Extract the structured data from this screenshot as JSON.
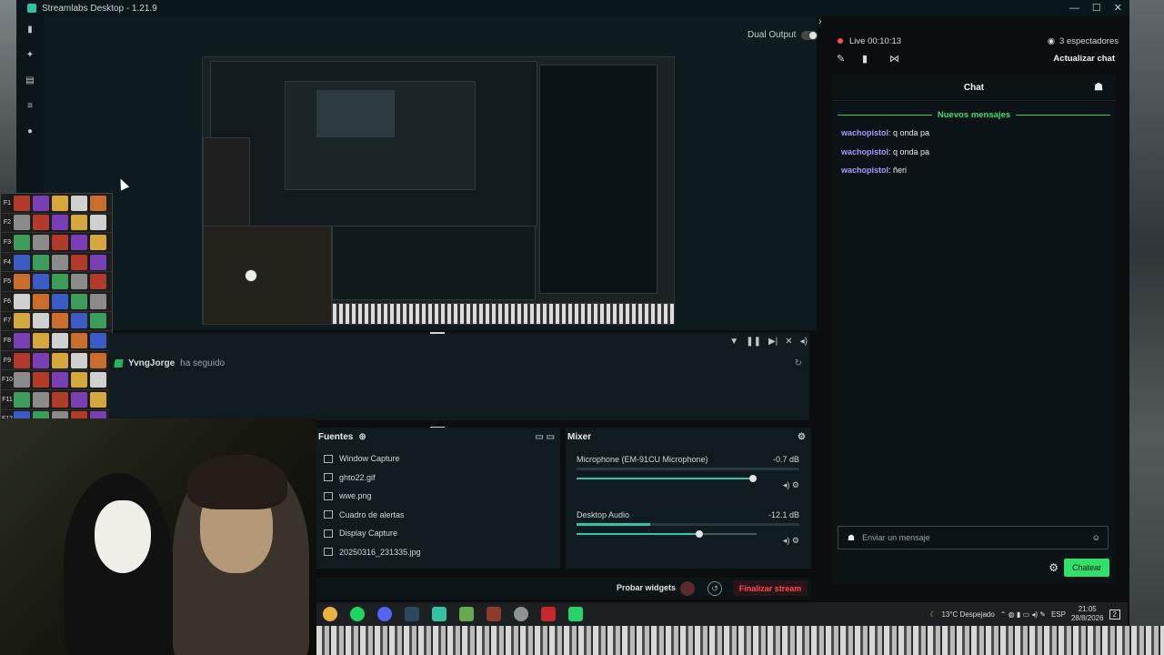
{
  "window": {
    "title": "Streamlabs Desktop - 1.21.9"
  },
  "editor": {
    "dual_output_label": "Dual Output"
  },
  "hotbar": {
    "keys": [
      "F1",
      "F2",
      "F3",
      "F4",
      "F5",
      "F6",
      "F7",
      "F8",
      "F9",
      "F10",
      "F11",
      "F12"
    ]
  },
  "activity": {
    "username": "YvngJorge",
    "action": "ha seguido"
  },
  "sources": {
    "title": "Fuentes",
    "items": [
      "Window Capture",
      "ghto22.gif",
      "wwe.png",
      "Cuadro de alertas",
      "Display Capture",
      "20250316_231335.jpg"
    ]
  },
  "mixer": {
    "title": "Mixer",
    "channels": [
      {
        "name": "Microphone (EM-91CU Microphone)",
        "db": "-0.7 dB",
        "volume": 0.98
      },
      {
        "name": "Desktop Audio",
        "db": "-12.1 dB",
        "volume": 0.68
      }
    ]
  },
  "bottombar": {
    "test_widgets": "Probar widgets",
    "end_stream": "Finalizar stream"
  },
  "live": {
    "status": "Live 00:10:13",
    "viewers": "3 espectadores",
    "refresh_chat": "Actualizar chat"
  },
  "chat": {
    "title": "Chat",
    "new_messages": "Nuevos mensajes",
    "messages": [
      {
        "user": "wachopistol",
        "text": ": q onda pa"
      },
      {
        "user": "wachopistol",
        "text": ": q onda pa"
      },
      {
        "user": "wachopistol",
        "text": ": ñeri"
      }
    ],
    "input_placeholder": "Enviar un mensaje",
    "send_label": "Chatear"
  },
  "taskbar": {
    "weather": "13°C  Despejado",
    "language": "ESP",
    "time": "21:05",
    "date": "28/8/2026",
    "notifications": "2"
  },
  "colors": {
    "accent": "#31c3a2",
    "chat_green": "#31e06a",
    "end_stream_red": "#ff4a5a",
    "username": "#a59bff"
  }
}
